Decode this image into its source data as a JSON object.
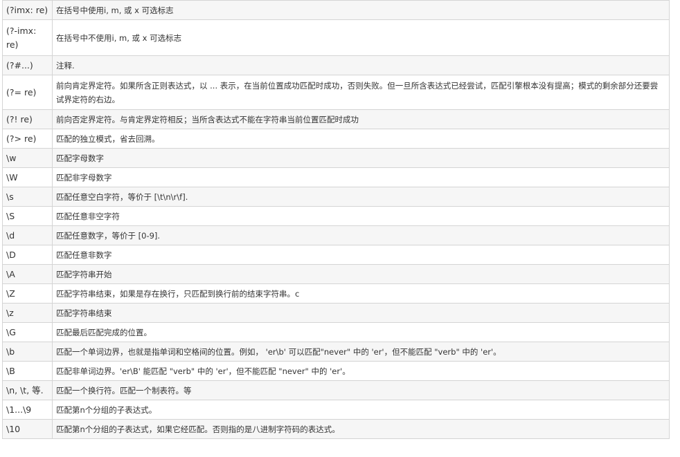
{
  "rows": [
    {
      "pattern": "(?imx: re)",
      "description": "在括号中使用i, m, 或 x 可选标志"
    },
    {
      "pattern": "(?-imx: re)",
      "description": "在括号中不使用i, m, 或 x 可选标志"
    },
    {
      "pattern": "(?#...)",
      "description": "注释."
    },
    {
      "pattern": "(?= re)",
      "description": "前向肯定界定符。如果所含正则表达式，以 ... 表示，在当前位置成功匹配时成功，否则失败。但一旦所含表达式已经尝试，匹配引擎根本没有提高；模式的剩余部分还要尝试界定符的右边。"
    },
    {
      "pattern": "(?! re)",
      "description": "前向否定界定符。与肯定界定符相反；当所含表达式不能在字符串当前位置匹配时成功"
    },
    {
      "pattern": "(?> re)",
      "description": "匹配的独立模式，省去回溯。"
    },
    {
      "pattern": "\\w",
      "description": "匹配字母数字"
    },
    {
      "pattern": "\\W",
      "description": "匹配非字母数字"
    },
    {
      "pattern": "\\s",
      "description": "匹配任意空白字符，等价于 [\\t\\n\\r\\f]."
    },
    {
      "pattern": "\\S",
      "description": "匹配任意非空字符"
    },
    {
      "pattern": "\\d",
      "description": "匹配任意数字，等价于 [0-9]."
    },
    {
      "pattern": "\\D",
      "description": "匹配任意非数字"
    },
    {
      "pattern": "\\A",
      "description": "匹配字符串开始"
    },
    {
      "pattern": "\\Z",
      "description": "匹配字符串结束，如果是存在换行，只匹配到换行前的结束字符串。c"
    },
    {
      "pattern": "\\z",
      "description": "匹配字符串结束"
    },
    {
      "pattern": "\\G",
      "description": "匹配最后匹配完成的位置。"
    },
    {
      "pattern": "\\b",
      "description": "匹配一个单词边界，也就是指单词和空格间的位置。例如， 'er\\b' 可以匹配\"never\" 中的 'er'，但不能匹配 \"verb\" 中的 'er'。"
    },
    {
      "pattern": "\\B",
      "description": "匹配非单词边界。'er\\B' 能匹配 \"verb\" 中的 'er'，但不能匹配 \"never\" 中的 'er'。"
    },
    {
      "pattern": "\\n, \\t, 等.",
      "description": "匹配一个换行符。匹配一个制表符。等"
    },
    {
      "pattern": "\\1...\\9",
      "description": "匹配第n个分组的子表达式。"
    },
    {
      "pattern": "\\10",
      "description": "匹配第n个分组的子表达式，如果它经匹配。否则指的是八进制字符码的表达式。"
    }
  ]
}
